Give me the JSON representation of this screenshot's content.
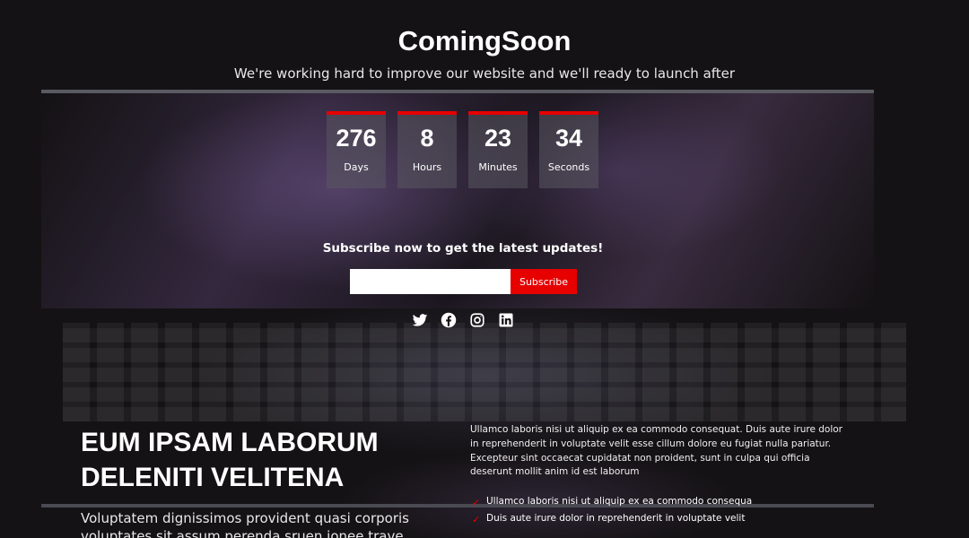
{
  "header": {
    "title": "ComingSoon",
    "tagline": "We're working hard to improve our website and we'll ready to launch after"
  },
  "countdown": [
    {
      "value": "276",
      "label": "Days"
    },
    {
      "value": "8",
      "label": "Hours"
    },
    {
      "value": "23",
      "label": "Minutes"
    },
    {
      "value": "34",
      "label": "Seconds"
    }
  ],
  "subscribe": {
    "heading": "Subscribe now to get the latest updates!",
    "email_value": "",
    "button_label": "Subscribe"
  },
  "social": [
    "twitter-icon",
    "facebook-icon",
    "instagram-icon",
    "linkedin-icon"
  ],
  "about": {
    "headline_line1": "EUM IPSAM LABORUM",
    "headline_line2": "DELENITI VELITENA",
    "lead": "Voluptatem dignissimos provident quasi corporis voluptates sit assum perenda sruen jonee trave",
    "paragraph": "Ullamco laboris nisi ut aliquip ex ea commodo consequat. Duis aute irure dolor in reprehenderit in voluptate velit esse cillum dolore eu fugiat nulla pariatur. Excepteur sint occaecat cupidatat non proident, sunt in culpa qui officia deserunt mollit anim id est laborum",
    "checklist": [
      "Ullamco laboris nisi ut aliquip ex ea commodo consequa",
      "Duis aute irure dolor in reprehenderit in voluptate velit"
    ]
  },
  "colors": {
    "accent": "#e60000",
    "background": "#141214"
  }
}
